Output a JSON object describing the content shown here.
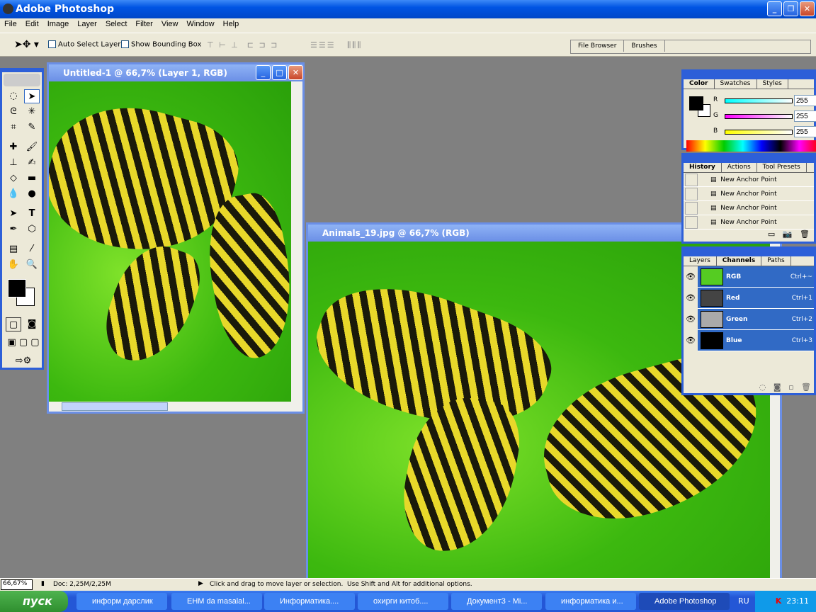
{
  "app": {
    "title": "Adobe Photoshop"
  },
  "menu": [
    "File",
    "Edit",
    "Image",
    "Layer",
    "Select",
    "Filter",
    "View",
    "Window",
    "Help"
  ],
  "options": {
    "auto_select": "Auto Select Layer",
    "bounding_box": "Show Bounding Box"
  },
  "palette_well": [
    "File Browser",
    "Brushes"
  ],
  "doc1": {
    "title": "Untitled-1 @ 66,7% (Layer 1, RGB)"
  },
  "doc2": {
    "title": "Animals_19.jpg @ 66,7% (RGB)"
  },
  "color_panel": {
    "tabs": [
      "Color",
      "Swatches",
      "Styles"
    ],
    "r_label": "R",
    "g_label": "G",
    "b_label": "B",
    "r": "255",
    "g": "255",
    "b": "255"
  },
  "history_panel": {
    "tabs": [
      "History",
      "Actions",
      "Tool Presets"
    ],
    "items": [
      "New Anchor Point",
      "New Anchor Point",
      "New Anchor Point",
      "New Anchor Point"
    ]
  },
  "channels_panel": {
    "tabs": [
      "Layers",
      "Channels",
      "Paths"
    ],
    "items": [
      {
        "name": "RGB",
        "shortcut": "Ctrl+~"
      },
      {
        "name": "Red",
        "shortcut": "Ctrl+1"
      },
      {
        "name": "Green",
        "shortcut": "Ctrl+2"
      },
      {
        "name": "Blue",
        "shortcut": "Ctrl+3"
      }
    ]
  },
  "status": {
    "zoom": "66,67%",
    "doc": "Doc: 2,25M/2,25M",
    "hint": "Click and drag to move layer or selection.  Use Shift and Alt for additional options."
  },
  "taskbar": {
    "start": "пуск",
    "tasks": [
      "информ дарслик",
      "EHM da masalal...",
      "Информатика....",
      "охирги китоб....",
      "Документ3 - Mi...",
      "информатика и...",
      "Adobe Photoshop"
    ],
    "lang": "RU",
    "clock": "23:11"
  }
}
